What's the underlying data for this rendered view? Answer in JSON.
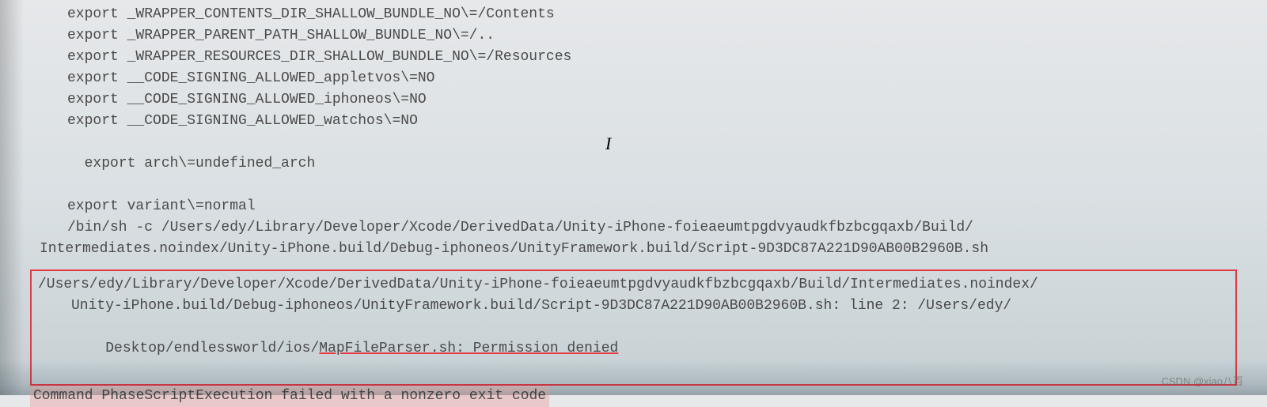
{
  "lines": {
    "l1": "export _WRAPPER_CONTENTS_DIR_SHALLOW_BUNDLE_NO\\=/Contents",
    "l2": "export _WRAPPER_PARENT_PATH_SHALLOW_BUNDLE_NO\\=/..",
    "l3": "export _WRAPPER_RESOURCES_DIR_SHALLOW_BUNDLE_NO\\=/Resources",
    "l4": "export __CODE_SIGNING_ALLOWED_appletvos\\=NO",
    "l5": "export __CODE_SIGNING_ALLOWED_iphoneos\\=NO",
    "l6": "export __CODE_SIGNING_ALLOWED_watchos\\=NO",
    "l7": "export arch\\=undefined_arch",
    "l8": "export variant\\=normal",
    "l9a": "/bin/sh -c /Users/edy/Library/Developer/Xcode/DerivedData/Unity-iPhone-foieaeumtpgdvyaudkfbzbcgqaxb/Build/",
    "l9b": "Intermediates.noindex/Unity-iPhone.build/Debug-iphoneos/UnityFramework.build/Script-9D3DC87A221D90AB00B2960B.sh"
  },
  "error": {
    "e1": "/Users/edy/Library/Developer/Xcode/DerivedData/Unity-iPhone-foieaeumtpgdvyaudkfbzbcgqaxb/Build/Intermediates.noindex/",
    "e2": "Unity-iPhone.build/Debug-iphoneos/UnityFramework.build/Script-9D3DC87A221D90AB00B2960B.sh: line 2: /Users/edy/",
    "e3a": "Desktop/endlessworld/ios/",
    "e3b": "MapFileParser.sh: Permission denied"
  },
  "summary": "Command PhaseScriptExecution failed with a nonzero exit code",
  "watermark": "CSDN @xiao八百"
}
